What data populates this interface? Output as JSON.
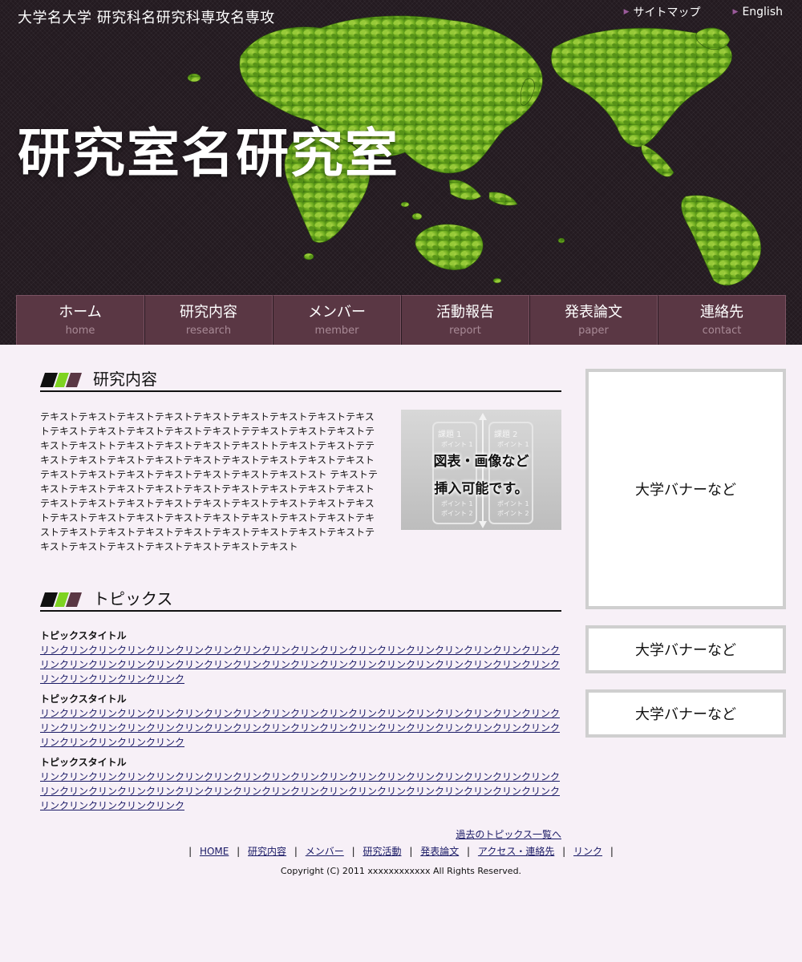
{
  "header": {
    "university": "大学名大学 研究科名研究科専攻名専攻",
    "lab_title": "研究室名研究室",
    "top_links": [
      {
        "label": "サイトマップ"
      },
      {
        "label": "English"
      }
    ]
  },
  "nav": [
    {
      "jp": "ホーム",
      "en": "home"
    },
    {
      "jp": "研究内容",
      "en": "research"
    },
    {
      "jp": "メンバー",
      "en": "member"
    },
    {
      "jp": "活動報告",
      "en": "report"
    },
    {
      "jp": "発表論文",
      "en": "paper"
    },
    {
      "jp": "連絡先",
      "en": "contact"
    }
  ],
  "research": {
    "heading": "研究内容",
    "text": "テキストテキストテキストテキストテキストテキストテキストテキストテキストテキストテキストテキストテキストテキストテテキストテキストテキストテキストテキストトテキストテキストテキストテキストトテキストテキストテテキストテキストテキストテキストテキストテキストテキストテキストテキストテキストテキストテキストテキストテキストテキストテキストスト テキストテキストテキストテキストテキストテキストテキストテキストテキストテキストテキストテキストテキストテキストテキストテキストテキストテキストテキストテキストテキストテキストテキストテキストテキストテキストテキストテキストテキストテキストテキストテキストテキストテキストテキストテキストテキストテキストテキストテキストテキストテキストテキスト",
    "figure": {
      "line1": "図表・画像など",
      "line2": "挿入可能です。",
      "box1": "課題 1",
      "box2": "課題 2",
      "point1": "ポイント 1",
      "point2": "ポイント 2"
    }
  },
  "topics": {
    "heading": "トピックス",
    "items": [
      {
        "title": "トピックスタイトル",
        "link": "リンクリンクリンクリンクリンクリンクリンクリンクリンクリンクリンクリンクリンクリンクリンクリンクリンクリンクリンクリンクリンクリンクリンクリンクリンクリンクリンクリンクリンクリンクリンクリンクリンクリンクリンクリンクリンクリンクリンクリンクリンク"
      },
      {
        "title": "トピックスタイトル",
        "link": "リンクリンクリンクリンクリンクリンクリンクリンクリンクリンクリンクリンクリンクリンクリンクリンクリンクリンクリンクリンクリンクリンクリンクリンクリンクリンクリンクリンクリンクリンクリンクリンクリンクリンクリンクリンクリンクリンクリンクリンクリンク"
      },
      {
        "title": "トピックスタイトル",
        "link": "リンクリンクリンクリンクリンクリンクリンクリンクリンクリンクリンクリンクリンクリンクリンクリンクリンクリンクリンクリンクリンクリンクリンクリンクリンクリンクリンクリンクリンクリンクリンクリンクリンクリンクリンクリンクリンクリンクリンクリンクリンク"
      }
    ],
    "more": "過去のトピックス一覧へ"
  },
  "sidebar": {
    "banners": [
      "大学バナーなど",
      "大学バナーなど",
      "大学バナーなど"
    ]
  },
  "footer": {
    "links": [
      "HOME",
      "研究内容",
      "メンバー",
      "研究活動",
      "発表論文",
      "アクセス・連絡先",
      "リンク"
    ],
    "separator": "|",
    "copyright": "Copyright (C) 2011 xxxxxxxxxxxx All Rights Reserved."
  },
  "colors": {
    "header_bg": "#231a20",
    "nav_bg": "#5a3744",
    "page_bg": "#f7f0f7",
    "accent_green": "#7ed321",
    "accent_purple": "#5a3744"
  }
}
